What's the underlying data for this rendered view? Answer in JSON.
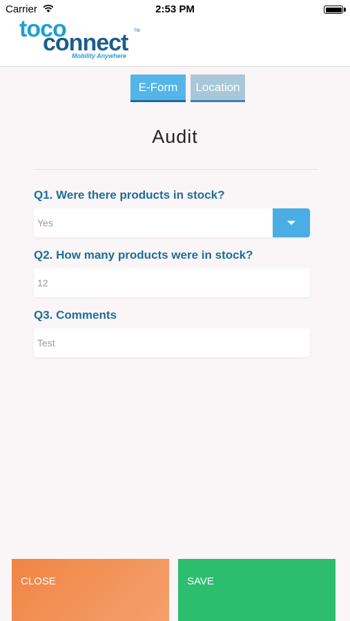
{
  "status_bar": {
    "carrier": "Carrier",
    "time": "2:53 PM",
    "wifi_icon": "wifi-icon",
    "battery_icon": "battery-icon"
  },
  "header": {
    "logo_text_1": "toco",
    "logo_text_2": "connect",
    "logo_tm": "TM",
    "logo_tagline": "Mobility Anywhere"
  },
  "tabs": [
    {
      "label": "E-Form",
      "active": true
    },
    {
      "label": "Location",
      "active": false
    }
  ],
  "form": {
    "title": "Audit",
    "questions": [
      {
        "label": "Q1. Were there products in stock?",
        "value": "Yes",
        "type": "dropdown"
      },
      {
        "label": "Q2. How many products were in stock?",
        "value": "12",
        "type": "text"
      },
      {
        "label": "Q3. Comments",
        "value": "Test",
        "type": "text"
      }
    ]
  },
  "actions": {
    "close_label": "CLOSE",
    "save_label": "SAVE"
  },
  "colors": {
    "accent": "#1e6e96",
    "tab_active": "#55b5e8",
    "tab_inactive": "#a8c7d8",
    "close": "#f08544",
    "save": "#2dbd6e"
  }
}
